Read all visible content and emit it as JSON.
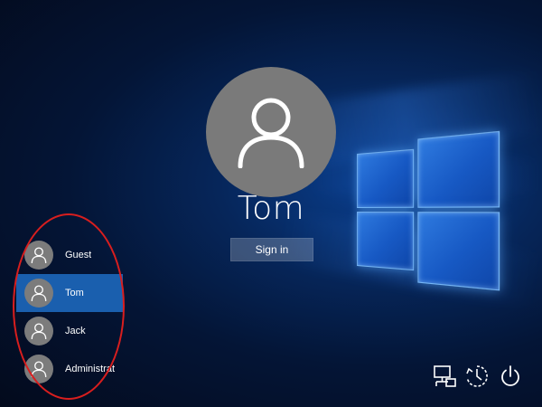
{
  "main_user": {
    "name": "Tom",
    "sign_in_label": "Sign in"
  },
  "users": [
    {
      "name": "Guest",
      "selected": false
    },
    {
      "name": "Tom",
      "selected": true
    },
    {
      "name": "Jack",
      "selected": false
    },
    {
      "name": "Administrat",
      "selected": false
    }
  ],
  "icons": {
    "network": "network-icon",
    "ease_of_access": "ease-of-access-icon",
    "power": "power-icon"
  },
  "colors": {
    "selected_user": "#1a5fae",
    "annotation_circle": "#d81e1e",
    "avatar": "#7a7a7a"
  }
}
